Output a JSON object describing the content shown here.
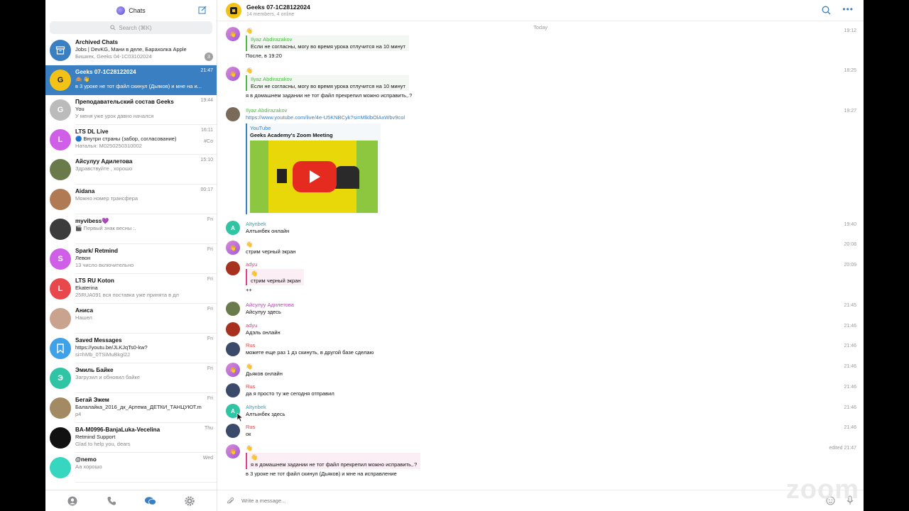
{
  "sidebar": {
    "title": "Chats",
    "search_placeholder": "Search (⌘K)",
    "chats": [
      {
        "name": "Archived Chats",
        "line1": "Jobs | DevKG, Мани в деле, Барахолка Apple",
        "line2": "Бишкек, Geeks 04-1C03102024",
        "time": "",
        "badge": "3",
        "avatar_color": "#3a7fc1",
        "avatar_text": "",
        "icon": "archive-icon"
      },
      {
        "name": "Geeks 07-1C28122024",
        "line1": "🙈 👋",
        "line2": "в 3 уроке не тот файл скинул (Дьяков) и мне на и...",
        "time": "21:47",
        "avatar_color": "#f2c316",
        "avatar_text": "G",
        "active": true
      },
      {
        "name": "Преподавательский состав Geeks",
        "line1": "You",
        "line2": "У меня уже урок давно начался",
        "time": "19:44",
        "avatar_color": "#bbb",
        "avatar_text": "G"
      },
      {
        "name": "LTS DL Live",
        "line1": "🔵 Внутри страны (забор, согласование)",
        "line2": "Наталья: M0250250310002",
        "time": "16:11",
        "avatar_color": "#cf5fe6",
        "avatar_text": "L",
        "tag": "#Co"
      },
      {
        "name": "Айсулуу Адилетова",
        "line1": "Здравствуйте , хорошо",
        "line2": "",
        "time": "15:10",
        "avatar_color": "#6b7a4b",
        "avatar_text": ""
      },
      {
        "name": "Aidana",
        "line1": "Можно номер трансфера",
        "line2": "",
        "time": "00:17",
        "avatar_color": "#b07a55",
        "avatar_text": ""
      },
      {
        "name": "myvibess💜",
        "line1": "🎬 Первый знак весны :.",
        "line2": "",
        "time": "Fri",
        "avatar_color": "#3c3c3c",
        "avatar_text": ""
      },
      {
        "name": "Spark/ Retmind",
        "line1": "Левон",
        "line2": "13 число включительно",
        "time": "Fri",
        "avatar_color": "#cf5fe6",
        "avatar_text": "S"
      },
      {
        "name": "LTS RU Koton",
        "line1": "Ekaterina",
        "line2": "25RUA091 вся поставка уже принята в дл",
        "time": "Fri",
        "avatar_color": "#e8484c",
        "avatar_text": "L"
      },
      {
        "name": "Аниса",
        "line1": "Нашел",
        "line2": "",
        "time": "Fri",
        "avatar_color": "#c9a38d",
        "avatar_text": ""
      },
      {
        "name": "Saved Messages",
        "line1": "https://youtu.be/JLKJqTs0-kw?",
        "line2": "si=hMb_0TSiMuBkgl2J",
        "time": "Fri",
        "avatar_color": "#3fa1e8",
        "avatar_text": "",
        "icon": "bookmark-icon"
      },
      {
        "name": "Эмиль Байке",
        "line1": "Загрузил и обновил байке",
        "line2": "",
        "time": "Fri",
        "avatar_color": "#2fc4a3",
        "avatar_text": "Э"
      },
      {
        "name": "Бегай Эжем",
        "line1": "Балалайка_2016_дк_Артема_ДЕТКИ_ТАНЦУЮТ.m",
        "line2": "p4",
        "time": "Fri",
        "avatar_color": "#a48a62",
        "avatar_text": ""
      },
      {
        "name": "BA-M0996-BanjaLuka-Vecelina",
        "line1": "Retmind Support",
        "line2": "Glad to help you, dears",
        "time": "Thu",
        "avatar_color": "#111",
        "avatar_text": ""
      },
      {
        "name": "@nemo",
        "line1": "Аа хорошо",
        "line2": "",
        "time": "Wed",
        "avatar_color": "#36d6c0",
        "avatar_text": ""
      }
    ]
  },
  "header": {
    "title": "Geeks 07-1C28122024",
    "subtitle": "14 members, 4 online"
  },
  "date_separator": "Today",
  "messages": [
    {
      "sender": "",
      "emoji": "👋",
      "reply_name": "Ilyaz Abdirazakov",
      "reply_text": "Если не согласны, могу во время урока отлучится на 10 минут",
      "text": "После, в 19:20",
      "time": "19:12"
    },
    {
      "sender": "",
      "emoji": "👋",
      "reply_name": "Ilyaz Abdirazakov",
      "reply_text": "Если не согласны, могу во время урока отлучится на 10 минут",
      "text": "я в домашнем задании не тот файл прекрепил можно исправить,.?",
      "time": "18:25"
    },
    {
      "sender": "Ilyaz Abdirazakov",
      "link": "https://www.youtube.com/live/4e-U5KNBCyk?si=MlklbOlAxWbv9col",
      "yt_site": "YouTube",
      "yt_title": "Geeks Academy's Zoom Meeting",
      "time": "19:27"
    },
    {
      "sender": "Altynbek",
      "text": "Алтынбек онлайн",
      "time": "19:40"
    },
    {
      "sender": "",
      "emoji": "👋",
      "text": "стрим черный экран",
      "time": "20:08"
    },
    {
      "sender": "adyu",
      "reply_emoji": "👋",
      "reply_text": "стрим черный экран",
      "text": "++",
      "time": "20:09"
    },
    {
      "sender": "Айсулуу Адилетова",
      "text": "Айсулуу здесь",
      "time": "21:45"
    },
    {
      "sender": "adyu",
      "text": "Адэль онлайн",
      "time": "21:46"
    },
    {
      "sender": "Rus",
      "text": "можете еще раз 1 дз скинуть, в другой базе сделаю",
      "time": "21:46"
    },
    {
      "sender": "",
      "emoji": "👋",
      "text": "Дьяков онлайн",
      "time": "21:46"
    },
    {
      "sender": "Rus",
      "text": "да я просто ту же сегодня отправил",
      "time": "21:46"
    },
    {
      "sender": "Altynbek",
      "text": "Алтынбек здесь",
      "time": "21:46"
    },
    {
      "sender": "Rus",
      "text": "ок",
      "time": "21:46"
    },
    {
      "sender": "",
      "emoji": "👋",
      "reply_emoji": "👋",
      "reply_text": "я в домашнем задании не тот файл прекрепил можно исправить,.?",
      "text": "в 3 уроке не тот файл скинул (Дьяков) и мне на исправление",
      "time": "edited 21:47"
    }
  ],
  "composer": {
    "placeholder": "Write a message..."
  },
  "watermark": "zoom",
  "colors": {
    "accent": "#3a7fc1",
    "active_chat": "#3a7fc1",
    "green_name": "#4fb846",
    "pink_name": "#e0408a"
  }
}
